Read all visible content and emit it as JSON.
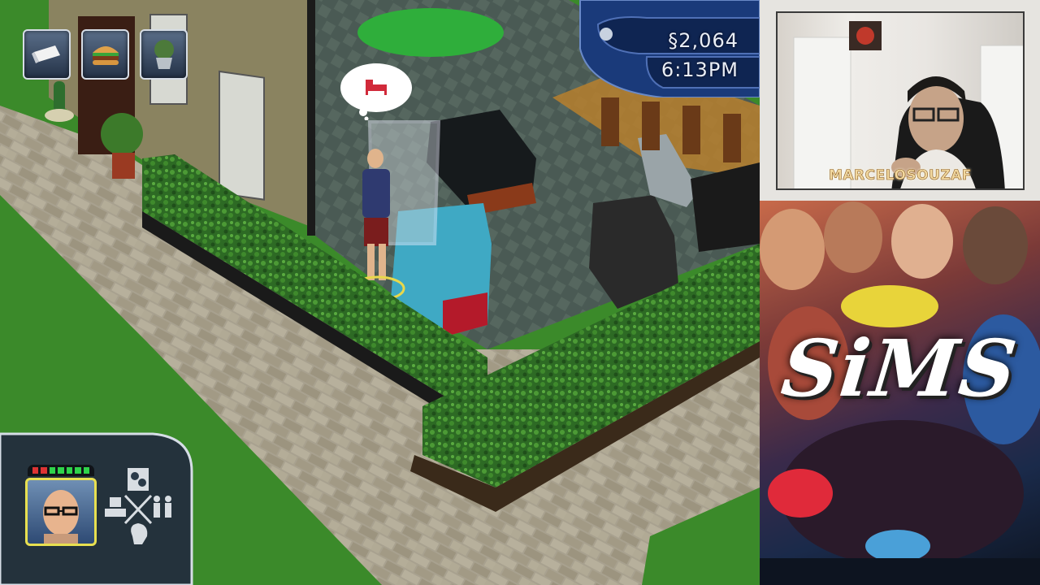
{
  "hud": {
    "money": "§2,064",
    "time": "6:13PM"
  },
  "queue": [
    {
      "icon": "tissue-icon"
    },
    {
      "icon": "burger-icon"
    },
    {
      "icon": "plant-icon"
    }
  ],
  "thought_bubble": {
    "icon": "bed-icon"
  },
  "sim_panel": {
    "mood_segments": [
      1,
      1,
      1,
      1,
      1,
      1,
      0,
      0,
      0
    ],
    "modes": [
      "mood-mode-icon",
      "personality-mode-icon",
      "relationship-mode-icon",
      "career-mode-icon"
    ]
  },
  "webcam": {
    "streamer": "MARCELOSOUZAF"
  },
  "cover_art": {
    "title": "SiMS"
  },
  "colors": {
    "hedge": "#2f6b25",
    "grass": "#3b8a2a",
    "brick": "#a8a18f",
    "hud_blue": "#1a3a7a",
    "selection_ring": "#e8d84a"
  }
}
